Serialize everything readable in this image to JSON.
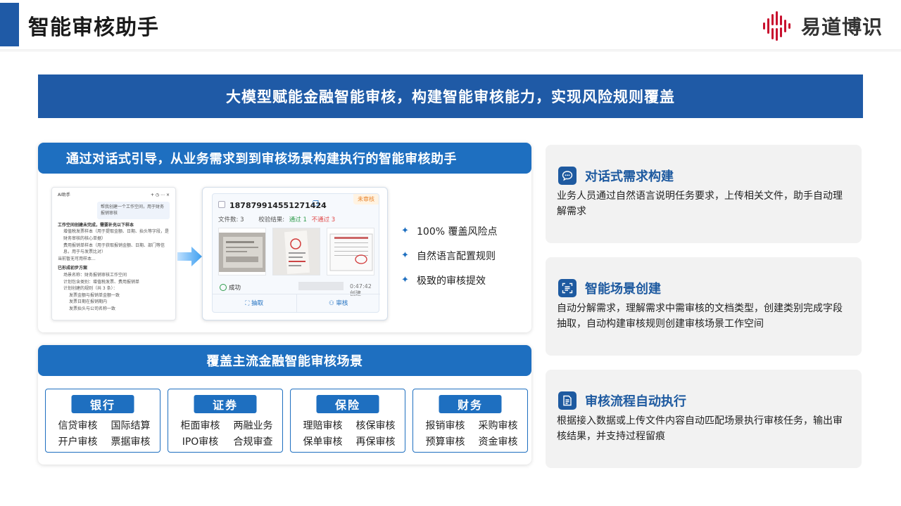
{
  "header": {
    "title": "智能审核助手",
    "brand": "易道博识",
    "brand_color": "#c8102e",
    "accent_color": "#1f5aa6"
  },
  "banner": {
    "text": "大模型赋能金融智能审核，构建智能审核能力，实现风险规则覆盖"
  },
  "assistant_card": {
    "title": "通过对话式引导，从业务需求到到审核场景构建执行的智能审核助手",
    "chat_panel": {
      "app_name": "AI助手",
      "controls": "+ ◷ ⋯ ×",
      "bubble": "帮我创建一个工作空间，用于财务报销审核",
      "section1": "工作空间创建未完成，需要补充以下样本",
      "item1": "增值税发票样本（用于提取金额、日期、抬头等字段，是财务审核的核心单据）",
      "item2": "费用报销单样本（用于获取报销金额、日期、部门等信息，用于与发票比对）",
      "note": "当前暂无可用样本...",
      "section2": "已形成初步方案",
      "plan1": "场景名称：财务报销审核工作空间",
      "plan2": "计划包含类别：增值税发票、费用报销单",
      "plan3": "计划创建的规则（共 3 条）：",
      "rule1": "发票金额与报销单金额一致",
      "rule2": "发票日期在报销期内",
      "rule3": "发票抬头与公司名称一致"
    },
    "doc_panel": {
      "id": "187879914551271424",
      "badge": "未审核",
      "file_count_label": "文件数: 3",
      "verify_label": "校验结果:",
      "pass_label": "通过 1",
      "fail_label": "不通过 3",
      "status": "成功",
      "time": "0:47:42 创建",
      "btn_extract": "抽取",
      "btn_review": "审核"
    },
    "features": [
      "100% 覆盖风险点",
      "自然语言配置规则",
      "极致的审核提效"
    ]
  },
  "scenarios_card": {
    "title": "覆盖主流金融智能审核场景",
    "categories": [
      {
        "name": "银行",
        "items": [
          "信贷审核",
          "国际结算",
          "开户审核",
          "票据审核"
        ]
      },
      {
        "name": "证券",
        "items": [
          "柜面审核",
          "两融业务",
          "IPO审核",
          "合规审查"
        ]
      },
      {
        "name": "保险",
        "items": [
          "理赔审核",
          "核保审核",
          "保单审核",
          "再保审核"
        ]
      },
      {
        "name": "财务",
        "items": [
          "报销审核",
          "采购审核",
          "预算审核",
          "资金审核"
        ]
      }
    ]
  },
  "right_cards": [
    {
      "icon": "chat-icon",
      "title": "对话式需求构建",
      "text": "业务人员通过自然语言说明任务要求，上传相关文件，助手自动理解需求"
    },
    {
      "icon": "scan-icon",
      "title": "智能场景创建",
      "text": "自动分解需求，理解需求中需审核的文档类型，创建类别完成字段抽取，自动构建审核规则创建审核场景工作空间"
    },
    {
      "icon": "document-icon",
      "title": "审核流程自动执行",
      "text": "根据接入数据或上传文件内容自动匹配场景执行审核任务，输出审核结果，并支持过程留痕"
    }
  ]
}
